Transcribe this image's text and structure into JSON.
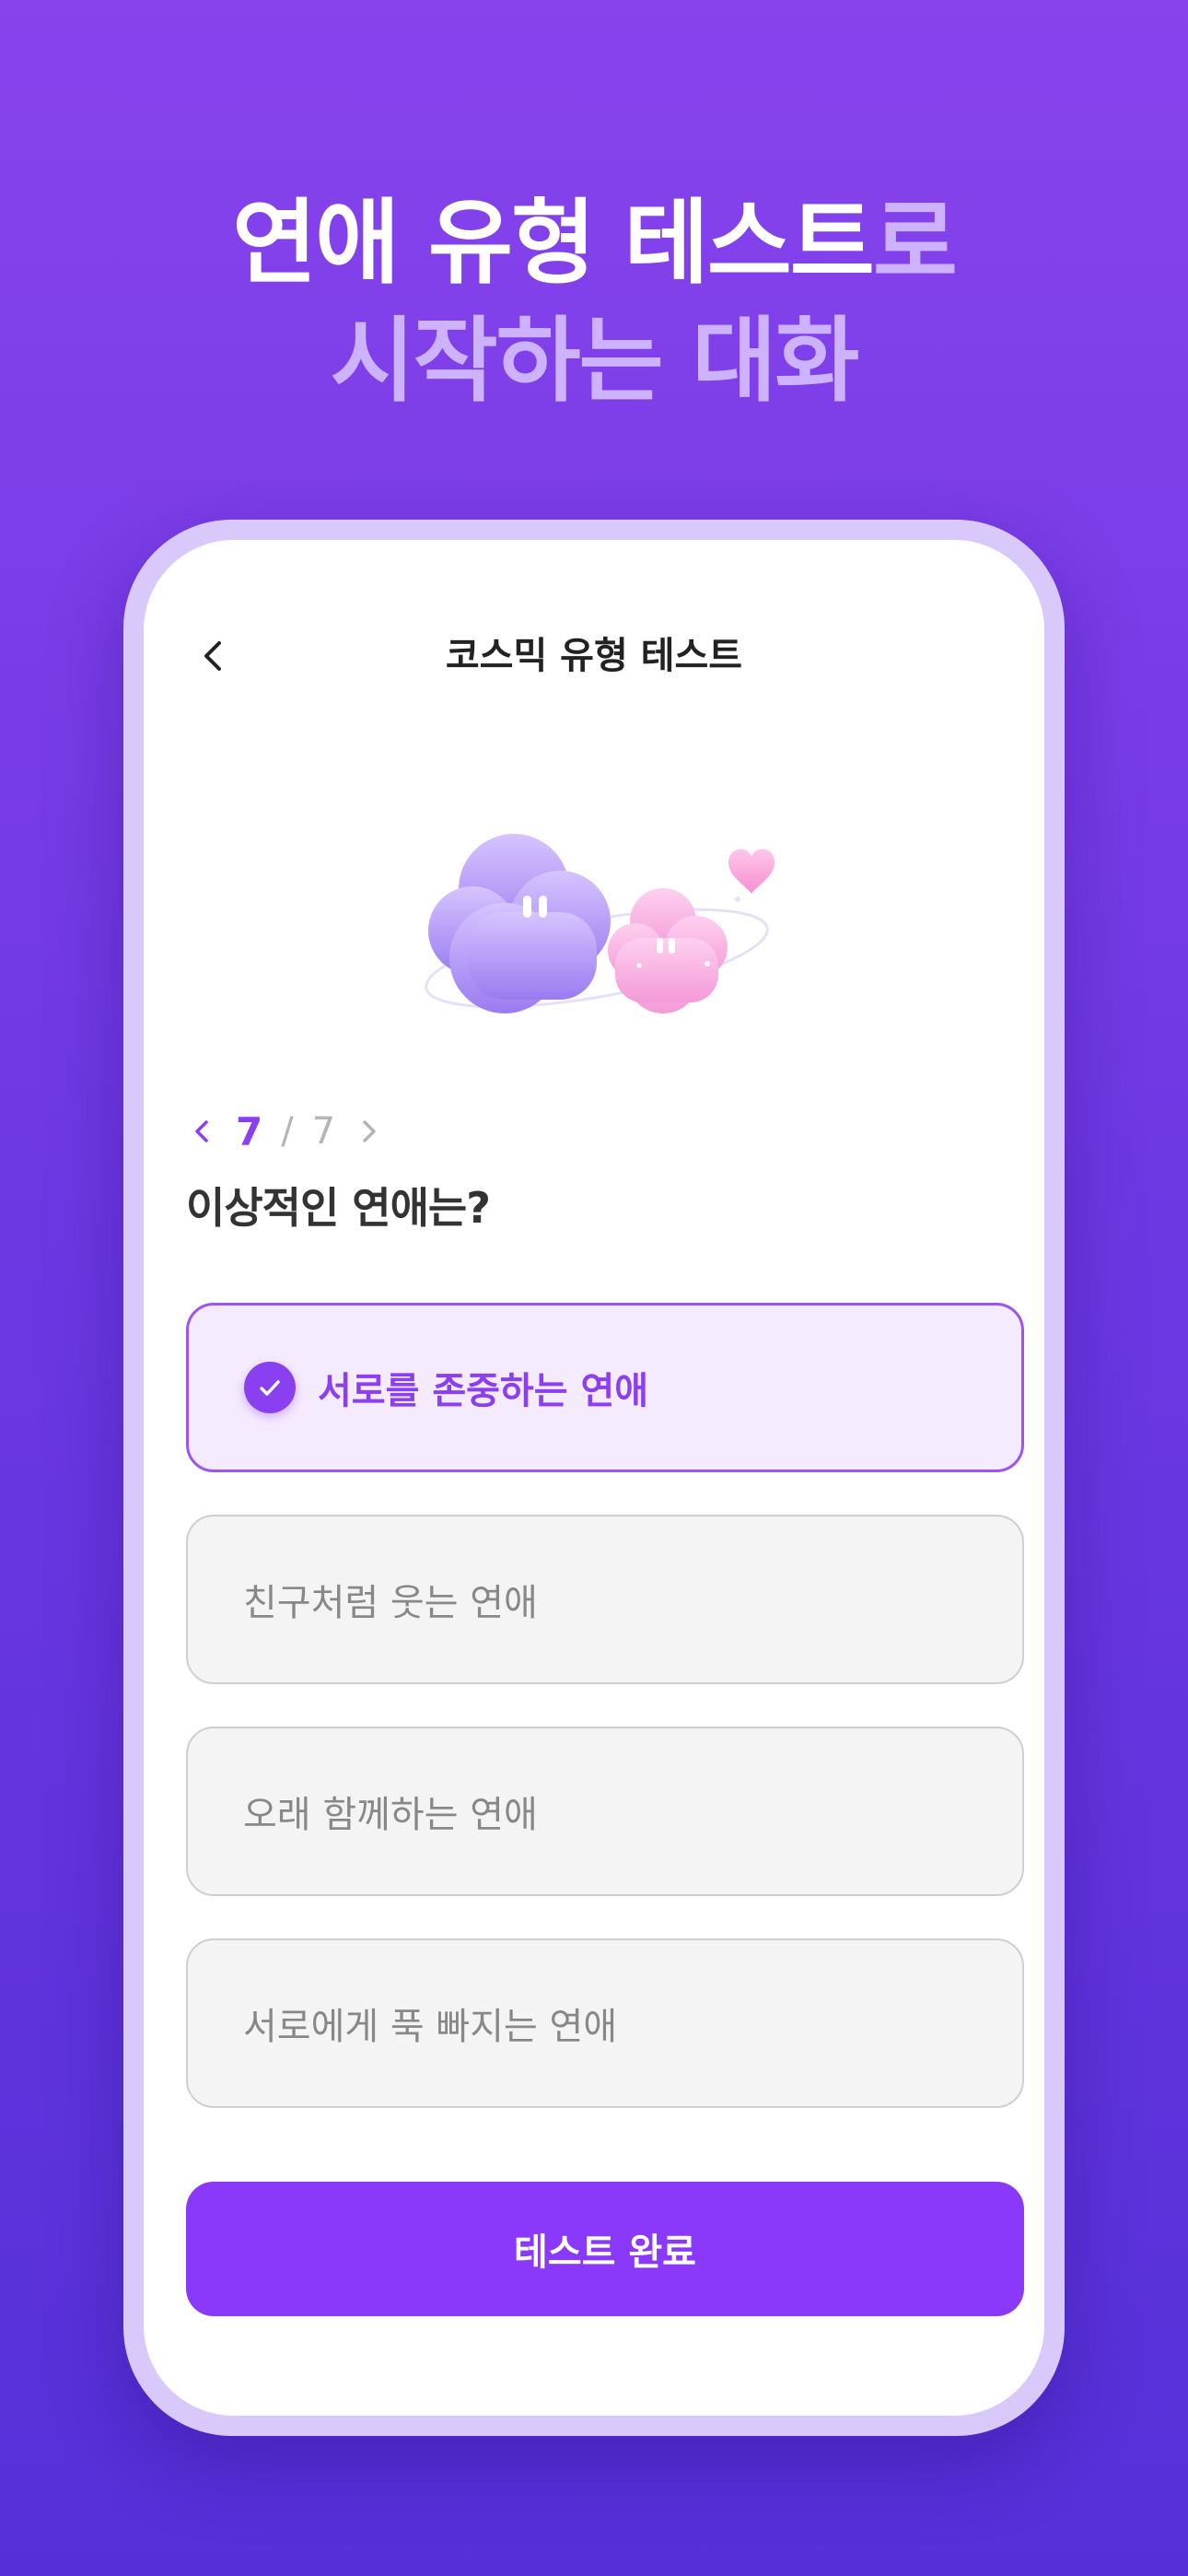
{
  "headline": {
    "line1_strong": "연애 유형 테스트",
    "line1_soft": "로",
    "line2_soft": "시작하는 대화"
  },
  "screen": {
    "title": "코스믹 유형 테스트",
    "back_icon": "chevron-left-icon"
  },
  "pager": {
    "current": "7",
    "separator": "/",
    "total": "7"
  },
  "question": "이상적인 연애는?",
  "options": [
    {
      "label": "서로를 존중하는 연애",
      "selected": true
    },
    {
      "label": "친구처럼 웃는 연애",
      "selected": false
    },
    {
      "label": "오래 함께하는 연애",
      "selected": false
    },
    {
      "label": "서로에게 푹 빠지는 연애",
      "selected": false
    }
  ],
  "cta_label": "테스트 완료",
  "colors": {
    "accent": "#8a38fa",
    "background_top": "#8743ec",
    "background_bottom": "#5530d8",
    "selected_fill": "#f5ebfe"
  }
}
